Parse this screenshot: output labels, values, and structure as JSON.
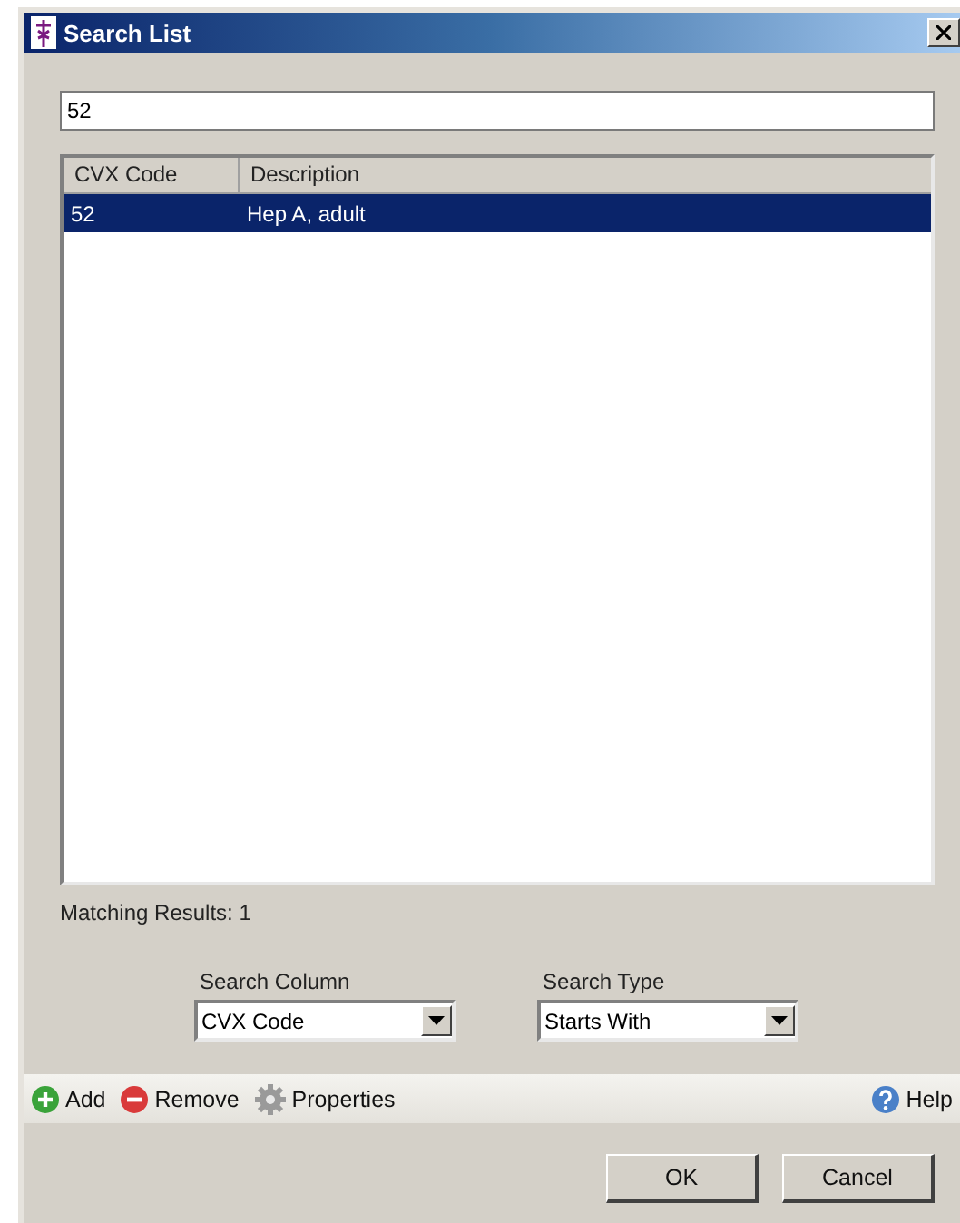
{
  "window": {
    "title": "Search List"
  },
  "search": {
    "value": "52"
  },
  "table": {
    "columns": [
      "CVX Code",
      "Description"
    ],
    "rows": [
      {
        "cells": [
          "52",
          "Hep A, adult"
        ],
        "selected": true
      }
    ]
  },
  "matching_results": "Matching Results: 1",
  "search_column": {
    "label": "Search Column",
    "value": "CVX Code"
  },
  "search_type": {
    "label": "Search Type",
    "value": "Starts With"
  },
  "toolbar": [
    {
      "kind": "add",
      "label": "Add"
    },
    {
      "kind": "remove",
      "label": "Remove"
    },
    {
      "kind": "properties",
      "label": "Properties"
    }
  ],
  "help": "Help",
  "buttons": [
    "OK",
    "Cancel"
  ]
}
